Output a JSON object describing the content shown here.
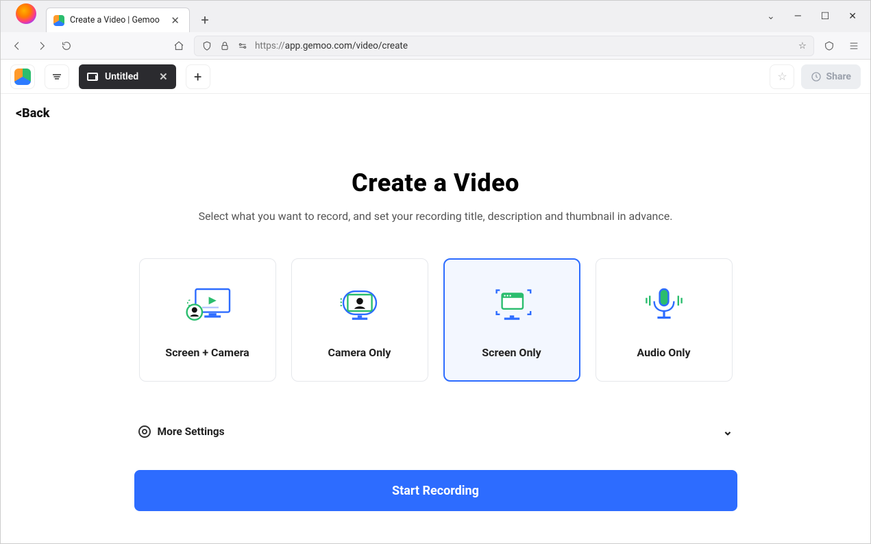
{
  "browser": {
    "tab_title": "Create a Video | Gemoo",
    "url_protocol": "https://",
    "url_rest": "app.gemoo.com/video/create"
  },
  "appbar": {
    "doc_title": "Untitled",
    "share_label": "Share"
  },
  "page": {
    "back_label": "<Back",
    "heading": "Create a Video",
    "subheading": "Select what you want to record, and set your recording title, description and thumbnail in advance.",
    "more_settings_label": "More Settings",
    "start_label": "Start Recording",
    "cards": {
      "screen_camera": "Screen + Camera",
      "camera_only": "Camera Only",
      "screen_only": "Screen Only",
      "audio_only": "Audio Only"
    }
  }
}
